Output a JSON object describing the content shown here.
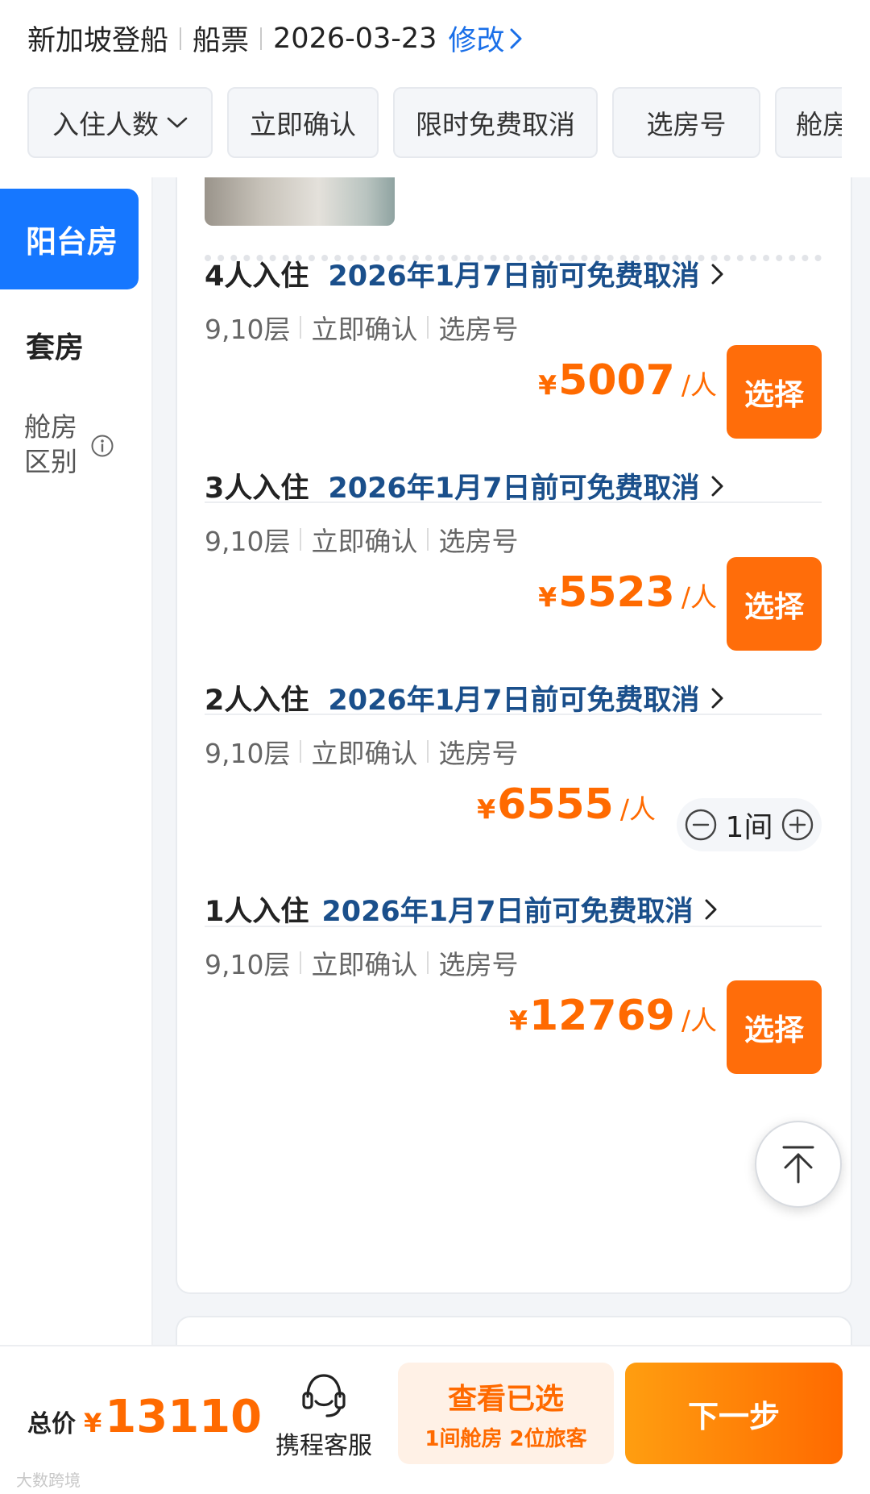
{
  "header": {
    "origin": "新加坡登船",
    "product": "船票",
    "date": "2026-03-23",
    "modify_label": "修改"
  },
  "filters": [
    {
      "label": "入住人数",
      "has_dropdown": true
    },
    {
      "label": "立即确认"
    },
    {
      "label": "限时免费取消"
    },
    {
      "label": "选房号"
    },
    {
      "label": "舱房"
    }
  ],
  "sidebar": {
    "items": [
      {
        "label": "阳台房",
        "active": true
      },
      {
        "label": "套房",
        "active": false
      }
    ],
    "diff_label_line1": "舱房",
    "diff_label_line2": "区别",
    "diff_icon": "info-icon"
  },
  "options": [
    {
      "occupancy": "4人入住",
      "cancel": "2026年1月7日前可免费取消",
      "tags": [
        "9,10层",
        "立即确认",
        "选房号"
      ],
      "currency": "¥",
      "price": "5007",
      "per": "/人",
      "action": "选择"
    },
    {
      "occupancy": "3人入住",
      "cancel": "2026年1月7日前可免费取消",
      "tags": [
        "9,10层",
        "立即确认",
        "选房号"
      ],
      "currency": "¥",
      "price": "5523",
      "per": "/人",
      "action": "选择"
    },
    {
      "occupancy": "2人入住",
      "cancel": "2026年1月7日前可免费取消",
      "tags": [
        "9,10层",
        "立即确认",
        "选房号"
      ],
      "currency": "¥",
      "price": "6555",
      "per": "/人",
      "quantity": "1间"
    },
    {
      "occupancy": "1人入住",
      "cancel": "2026年1月7日前可免费取消",
      "tags": [
        "9,10层",
        "立即确认",
        "选房号"
      ],
      "currency": "¥",
      "price": "12769",
      "per": "/人",
      "action": "选择"
    }
  ],
  "bottom": {
    "total_label": "总价",
    "currency": "¥",
    "total_value": "13110",
    "service_label": "携程客服",
    "selected_title": "查看已选",
    "selected_sub": "1间舱房 2位旅客",
    "next_label": "下一步",
    "watermark": "大数跨境"
  },
  "colors": {
    "accent_blue": "#1677ff",
    "link_blue": "#1a6fe8",
    "cancel_blue": "#1a4f8b",
    "price_orange": "#ff6a00"
  }
}
